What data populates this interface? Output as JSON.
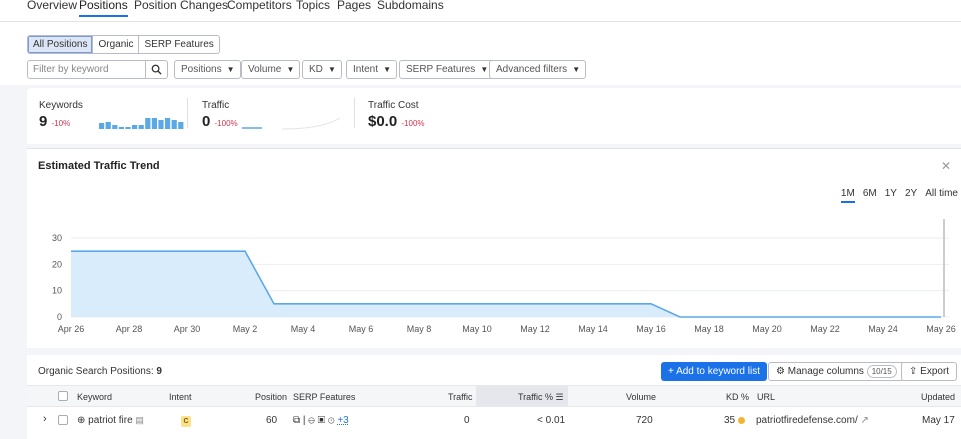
{
  "colors": {
    "accent": "#1b72e8",
    "negative": "#d1344b",
    "kd_dot": "#f2b530",
    "chart_line": "#5aa9e6",
    "chart_fill": "#d9ecfb",
    "sparkline": "#5aa9e6"
  },
  "nav": {
    "tabs": [
      "Overview",
      "Positions",
      "Position Changes",
      "Competitors",
      "Topics",
      "Pages",
      "Subdomains"
    ],
    "active": "Positions"
  },
  "filters": {
    "segments": [
      "All Positions",
      "Organic",
      "SERP Features"
    ],
    "active_segment": "All Positions",
    "search_placeholder": "Filter by keyword",
    "dropdowns": [
      "Positions",
      "Volume",
      "KD",
      "Intent",
      "SERP Features",
      "Advanced filters"
    ]
  },
  "metrics": {
    "keywords": {
      "label": "Keywords",
      "value": "9",
      "change": "-10%",
      "spark": [
        3,
        4,
        2,
        1,
        1,
        2,
        2,
        6,
        6,
        5,
        6,
        5,
        4
      ]
    },
    "traffic": {
      "label": "Traffic",
      "value": "0",
      "change": "-100%"
    },
    "traffic_cost": {
      "label": "Traffic Cost",
      "value": "$0.0",
      "change": "-100%"
    }
  },
  "trend": {
    "title": "Estimated Traffic Trend",
    "close_icon": "close-icon",
    "ranges": [
      "1M",
      "6M",
      "1Y",
      "2Y",
      "All time"
    ],
    "active_range": "1M"
  },
  "chart_data": {
    "type": "area",
    "title": "Estimated Traffic Trend",
    "xlabel": "",
    "ylabel": "",
    "ylim": [
      0,
      30
    ],
    "yticks": [
      0,
      10,
      20,
      30
    ],
    "x_tick_labels": [
      "Apr 26",
      "Apr 28",
      "Apr 30",
      "May 2",
      "May 4",
      "May 6",
      "May 8",
      "May 10",
      "May 12",
      "May 14",
      "May 16",
      "May 18",
      "May 20",
      "May 22",
      "May 24",
      "May 26"
    ],
    "x": [
      "Apr 26",
      "May 2",
      "May 3",
      "May 16",
      "May 17",
      "May 26"
    ],
    "values": [
      25,
      25,
      5,
      5,
      0,
      0
    ],
    "grid": true,
    "legend": "none"
  },
  "table": {
    "title_prefix": "Organic Search Positions:",
    "count": "9",
    "add_button": "+ Add to keyword list",
    "manage_button": "Manage columns",
    "manage_count": "10/15",
    "export_button": "Export",
    "columns": [
      "Keyword",
      "Intent",
      "Position",
      "SERP Features",
      "Traffic",
      "Traffic %",
      "Volume",
      "KD %",
      "URL",
      "Updated"
    ],
    "rows": [
      {
        "keyword": "patriot fire",
        "intent": "C",
        "position": "60",
        "serp_more": "+3",
        "traffic": "0",
        "traffic_pct": "< 0.01",
        "volume": "720",
        "kd": "35",
        "url": "patriotfiredefense.com/",
        "updated": "May 17"
      }
    ]
  }
}
